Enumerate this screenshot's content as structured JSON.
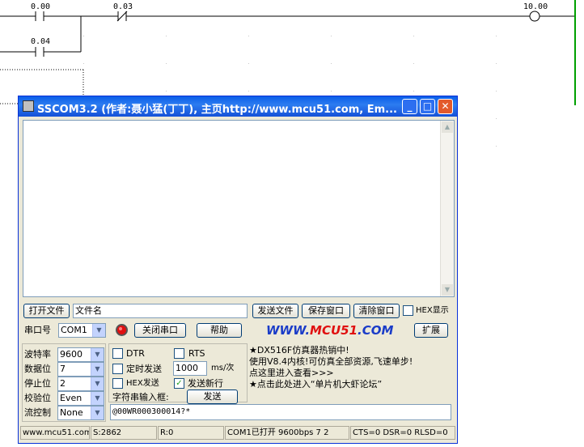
{
  "ladder": {
    "contacts": [
      "0.00",
      "0.03",
      "0.04"
    ],
    "coil": "10.00"
  },
  "window": {
    "title": "SSCOM3.2 (作者:聂小猛(丁丁), 主页http://www.mcu51.com, Em...",
    "minimize_glyph": "_",
    "maximize_glyph": "□",
    "close_glyph": "✕"
  },
  "toolbar": {
    "open_file": "打开文件",
    "filename": "文件名",
    "send_file": "发送文件",
    "save_window": "保存窗口",
    "clear_window": "清除窗口",
    "hex_display": "HEX显示"
  },
  "port_row": {
    "port_label": "串口号",
    "port_value": "COM1",
    "close_port": "关闭串口",
    "help": "帮助",
    "brand_prefix": "WWW.",
    "brand_mid": "MCU51",
    "brand_suffix": ".COM",
    "expand": "扩展"
  },
  "settings": {
    "baud_label": "波特率",
    "baud_value": "9600",
    "data_label": "数据位",
    "data_value": "7",
    "stop_label": "停止位",
    "stop_value": "2",
    "parity_label": "校验位",
    "parity_value": "Even",
    "flow_label": "流控制",
    "flow_value": "None"
  },
  "send_opts": {
    "dtr": "DTR",
    "rts": "RTS",
    "timed_send": "定时发送",
    "interval": "1000",
    "interval_unit": "ms/次",
    "hex_send": "HEX发送",
    "send_newline": "发送新行",
    "send_newline_checked": "✓",
    "string_input_label": "字符串输入框:",
    "send": "发送",
    "input_value": "@00WR000300014?*"
  },
  "ad": {
    "line1": "★DX516F仿真器热销中!",
    "line2": "使用V8.4内核!可仿真全部资源,飞速单步!",
    "line3": "点这里进入查看>>>",
    "line4": "★点击此处进入“单片机大虾论坛”"
  },
  "statusbar": {
    "site": "www.mcu51.com",
    "sent": "S:2862",
    "received": "R:0",
    "port_state": "COM1已打开  9600bps  7 2",
    "signals": "CTS=0 DSR=0 RLSD=0"
  },
  "colors": {
    "title_bar": "#0a5ee8",
    "brand_blue": "#1a3cc8",
    "brand_red": "#e01010"
  }
}
